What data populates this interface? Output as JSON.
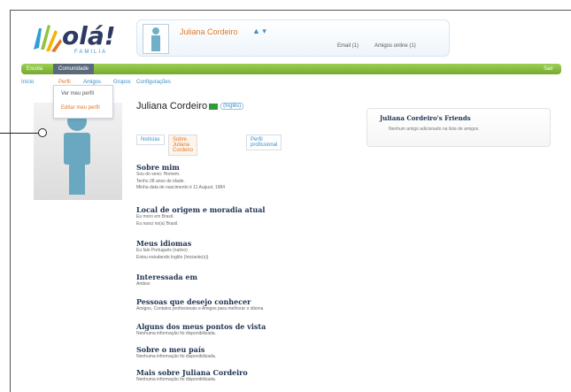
{
  "brand": {
    "logo_text": "olá!",
    "logo_sub": "FAMILIA"
  },
  "header": {
    "user_name": "Juliana Cordeiro",
    "user_menu": "▲ ▾",
    "email_link": "Email (1)",
    "friends_online": "Amigos online (1)"
  },
  "nav": {
    "items": [
      "Escola",
      "Comunidade"
    ],
    "active_index": 1,
    "right": "Sair"
  },
  "subnav": {
    "items": [
      "Início",
      "Perfil",
      "Amigos",
      "Grupos",
      "Configurações"
    ],
    "active_index": 1
  },
  "dropdown": {
    "items": [
      "Ver meu perfil",
      "Editar meu perfil"
    ]
  },
  "profile": {
    "name": "Juliana Cordeiro",
    "language_pill": "(Inglês)"
  },
  "tabs": [
    "Notícias",
    "Sobre Juliana Cordeiro",
    "Perfil profissional"
  ],
  "active_tab": 1,
  "sections": [
    {
      "title": "Sobre mim",
      "lines": [
        "Sou do sexo: Homem.",
        "Tenho 28 anos de idade.",
        "Minha data de nascimento é 11 August, 1984"
      ]
    },
    {
      "title": "Local de origem e moradia atual",
      "lines": [
        "Eu moro em Brasil.",
        "Eu nasci no(a) Brasil."
      ]
    },
    {
      "title": "Meus idiomas",
      "lines": [
        "Eu falo Português (nativo)",
        "Estou estudando Inglês (Iniciante(s))"
      ]
    },
    {
      "title": "Interessada em",
      "lines": [
        "Ambos"
      ]
    },
    {
      "title": "Pessoas que desejo conhecer",
      "lines": [
        "Amigos, Contatos profissionais e Amigos para melhorar o idioma"
      ]
    },
    {
      "title": "Alguns dos meus pontos de vista",
      "lines": [
        "Nenhuma informação foi disponibilizada."
      ]
    },
    {
      "title": "Sobre o meu país",
      "lines": [
        "Nenhuma informação foi disponibilizada."
      ]
    },
    {
      "title": "Mais sobre Juliana Cordeiro",
      "lines": [
        "Nenhuma informação foi disponibilizada."
      ]
    }
  ],
  "friends_box": {
    "title": "Juliana Cordeiro's Friends",
    "empty": "Nenhum amigo adicionado na lista de amigos."
  },
  "colors": {
    "green": "#8cc63f",
    "accent_orange": "#e0782a",
    "link_blue": "#3a8fc9",
    "navy": "#1e3250"
  }
}
